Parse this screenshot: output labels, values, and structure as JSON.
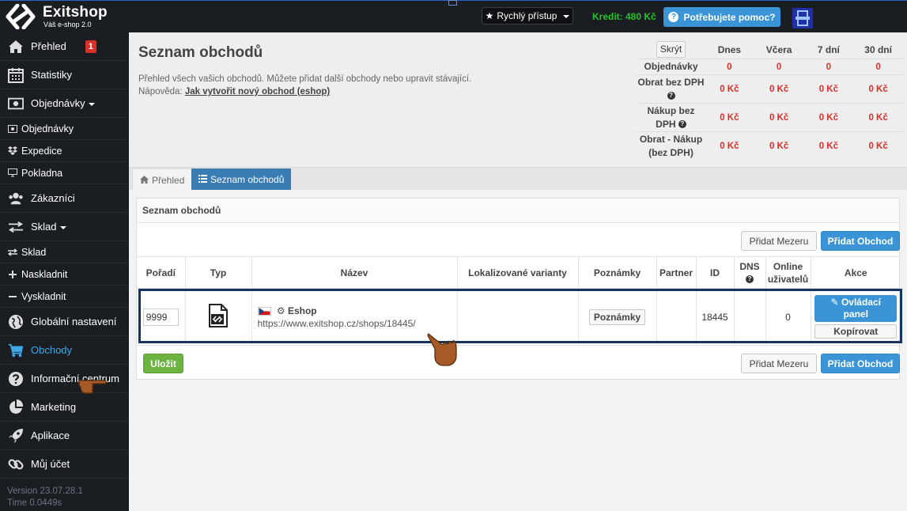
{
  "topbar": {
    "brand_title": "Exitshop",
    "brand_subtitle": "Váš e-shop 2.0",
    "quick_access": "Rychlý přístup",
    "credit": "Kredit: 480 Kč",
    "help": "Potřebujete pomoc?"
  },
  "sidebar": {
    "overview": "Přehled",
    "overview_badge": "1",
    "stats": "Statistiky",
    "orders_group": "Objednávky",
    "orders": "Objednávky",
    "dispatch": "Expedice",
    "pos": "Pokladna",
    "customers": "Zákazníci",
    "stock_group": "Sklad",
    "stock": "Sklad",
    "stock_in": "Naskladnit",
    "stock_out": "Vyskladnit",
    "global_settings": "Globální nastavení",
    "shops": "Obchody",
    "info_center": "Informační centrum",
    "marketing": "Marketing",
    "apps": "Aplikace",
    "account": "Můj účet",
    "version": "Version 23.07.28.1",
    "time": "Time 0.0449s"
  },
  "header": {
    "title": "Seznam obchodů",
    "description": "Přehled všech vašich obchodů. Můžete přidat další obchody nebo upravit stávající.",
    "help_prefix": "Nápověda:",
    "help_link": "Jak vytvořit nový obchod (eshop)"
  },
  "stats": {
    "hide_label": "Skrýt",
    "columns": [
      "Dnes",
      "Včera",
      "7 dní",
      "30 dní"
    ],
    "rows": [
      {
        "label": "Objednávky",
        "help": false,
        "values": [
          "0",
          "0",
          "0",
          "0"
        ]
      },
      {
        "label": "Obrat bez DPH",
        "help": true,
        "values": [
          "0 Kč",
          "0 Kč",
          "0 Kč",
          "0 Kč"
        ]
      },
      {
        "label": "Nákup bez DPH",
        "help": true,
        "values": [
          "0 Kč",
          "0 Kč",
          "0 Kč",
          "0 Kč"
        ]
      },
      {
        "label": "Obrat - Nákup (bez DPH)",
        "help": false,
        "values": [
          "0 Kč",
          "0 Kč",
          "0 Kč",
          "0 Kč"
        ]
      }
    ]
  },
  "tabs": {
    "overview": "Přehled",
    "shops": "Seznam obchodů"
  },
  "box": {
    "title": "Seznam obchodů",
    "add_gap": "Přidat Mezeru",
    "add_shop": "Přidat Obchod",
    "save": "Uložit"
  },
  "table": {
    "headers": {
      "order": "Pořadí",
      "type": "Typ",
      "name": "Název",
      "variants": "Lokalizované varianty",
      "notes": "Poznámky",
      "partner": "Partner",
      "id": "ID",
      "dns": "DNS",
      "online_1": "Online",
      "online_2": "uživatelů",
      "actions": "Akce"
    },
    "row": {
      "order": "9999",
      "name": "Eshop",
      "url": "https://www.exitshop.cz/shops/18445/",
      "notes_btn": "Poznámky",
      "id": "18445",
      "online": "0",
      "panel_1": "Ovládací",
      "panel_2": "panel",
      "copy": "Kopírovat"
    }
  },
  "colors": {
    "primary": "#3a94d6",
    "active_tab": "#3a7cb4",
    "danger": "#d9302c",
    "success": "#6cb33f",
    "credit": "#27c227",
    "sidebar_bg": "#1a1e23",
    "highlight": "#14365e"
  }
}
